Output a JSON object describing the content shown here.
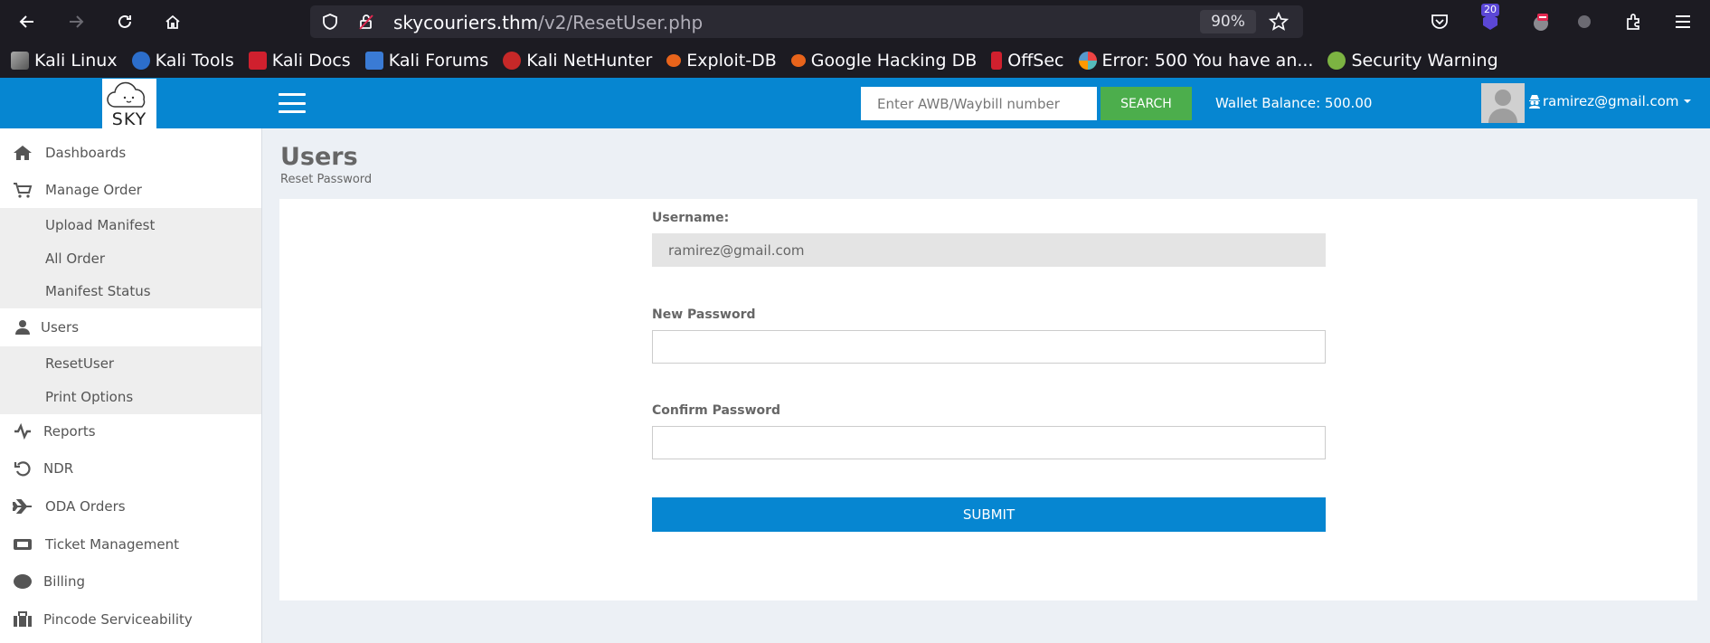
{
  "browser": {
    "url_host": "skycouriers.thm",
    "url_path": "/v2/ResetUser.php",
    "zoom": "90%",
    "extension_badge": "20",
    "bookmarks": [
      {
        "label": "Kali Linux",
        "icon": "kali-dragon-icon"
      },
      {
        "label": "Kali Tools",
        "icon": "kali-tools-icon"
      },
      {
        "label": "Kali Docs",
        "icon": "kali-docs-icon"
      },
      {
        "label": "Kali Forums",
        "icon": "kali-forums-icon"
      },
      {
        "label": "Kali NetHunter",
        "icon": "nethunter-icon"
      },
      {
        "label": "Exploit-DB",
        "icon": "exploit-db-icon"
      },
      {
        "label": "Google Hacking DB",
        "icon": "ghdb-icon"
      },
      {
        "label": "OffSec",
        "icon": "offsec-icon"
      },
      {
        "label": "Error: 500 You have an...",
        "icon": "joomla-icon"
      },
      {
        "label": "Security Warning",
        "icon": "warning-icon"
      }
    ]
  },
  "header": {
    "logo_text": "SKY",
    "search_placeholder": "Enter AWB/Waybill number",
    "search_button": "SEARCH",
    "wallet": "Wallet Balance: 500.00",
    "user_email": "ramirez@gmail.com"
  },
  "sidebar": {
    "items": [
      {
        "label": "Dashboards",
        "icon": "home-icon"
      },
      {
        "label": "Manage Order",
        "icon": "cart-icon"
      },
      {
        "label": "Users",
        "icon": "user-icon"
      },
      {
        "label": "Reports",
        "icon": "reports-icon"
      },
      {
        "label": "NDR",
        "icon": "undo-icon"
      },
      {
        "label": "ODA Orders",
        "icon": "plane-icon"
      },
      {
        "label": "Ticket Management",
        "icon": "ticket-icon"
      },
      {
        "label": "Billing",
        "icon": "billing-icon"
      },
      {
        "label": "Pincode Serviceability",
        "icon": "briefcase-icon"
      }
    ],
    "manage_order_sub": [
      "Upload Manifest",
      "All Order",
      "Manifest Status"
    ],
    "users_sub": [
      "ResetUser",
      "Print Options"
    ]
  },
  "main": {
    "title": "Users",
    "subtitle": "Reset Password",
    "username_label": "Username:",
    "username_value": "ramirez@gmail.com",
    "new_password_label": "New Password",
    "confirm_password_label": "Confirm Password",
    "submit_label": "SUBMIT"
  },
  "colors": {
    "header_blue": "#0686d1",
    "search_green": "#4cae4c",
    "browser_dark": "#1c1b22"
  }
}
